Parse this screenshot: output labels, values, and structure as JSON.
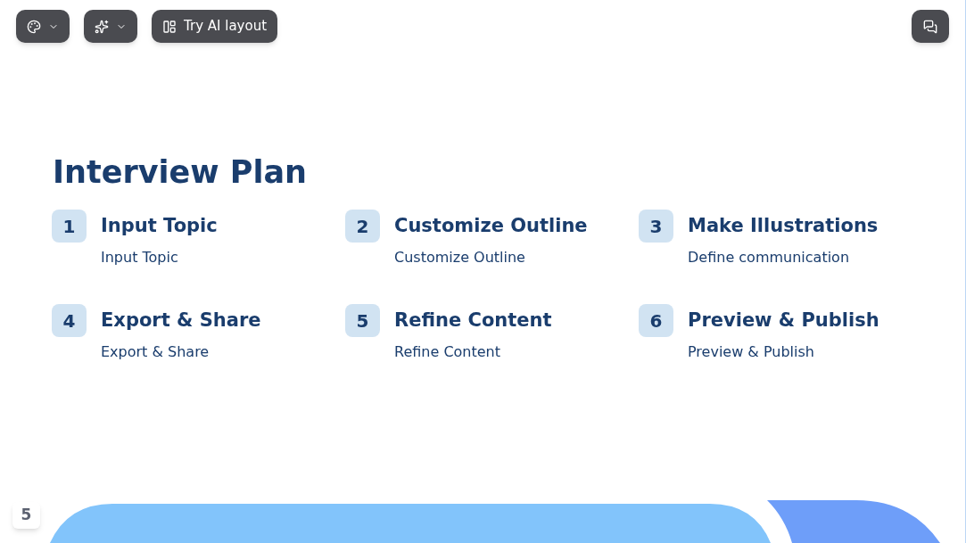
{
  "toolbar": {
    "ai_layout_button": "Try AI layout"
  },
  "slide": {
    "title": "Interview Plan",
    "steps": [
      {
        "number": "1",
        "heading": "Input Topic",
        "text": "Input Topic"
      },
      {
        "number": "2",
        "heading": "Customize Outline",
        "text": "Customize Outline"
      },
      {
        "number": "3",
        "heading": "Make Illustrations",
        "text": "Define communication"
      },
      {
        "number": "4",
        "heading": "Export & Share",
        "text": "Export & Share"
      },
      {
        "number": "5",
        "heading": "Refine Content",
        "text": "Refine Content"
      },
      {
        "number": "6",
        "heading": "Preview & Publish",
        "text": "Preview & Publish"
      }
    ]
  },
  "page_number": "5"
}
